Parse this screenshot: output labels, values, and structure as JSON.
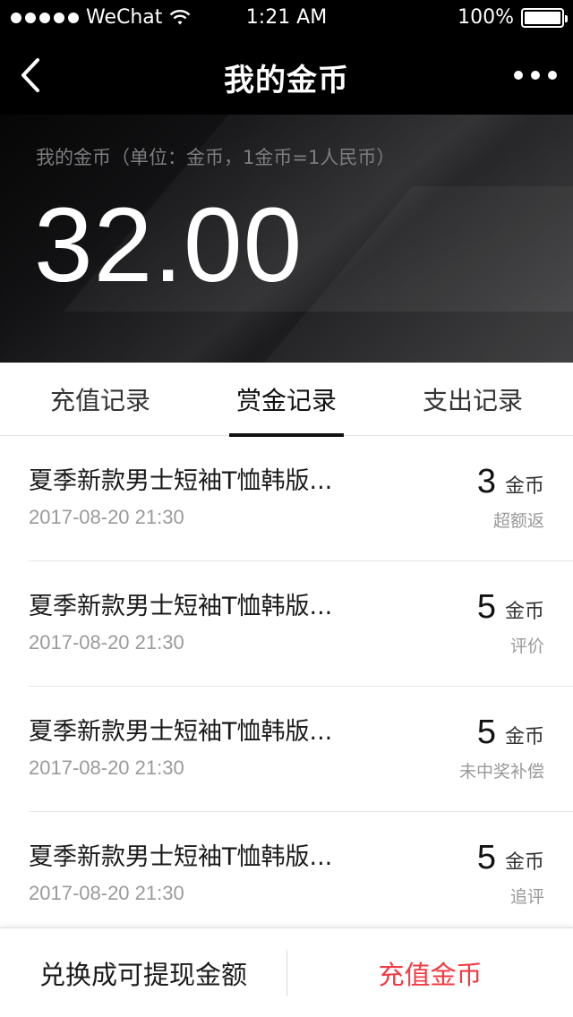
{
  "status_bar": {
    "carrier": "WeChat",
    "time": "1:21 AM",
    "battery": "100%",
    "battery_level": 1.0
  },
  "nav": {
    "title": "我的金币",
    "back_icon": "chevron-left-icon",
    "more_icon": "more-dots-icon"
  },
  "balance": {
    "caption": "我的金币（单位：金币，1金币=1人民币）",
    "amount": "32.00"
  },
  "tabs": [
    {
      "label": "充值记录",
      "active": false
    },
    {
      "label": "赏金记录",
      "active": true
    },
    {
      "label": "支出记录",
      "active": false
    }
  ],
  "records": [
    {
      "title": "夏季新款男士短袖T恤韩版...",
      "time": "2017-08-20 21:30",
      "amount": "3",
      "unit": "金币",
      "tag": "超额返"
    },
    {
      "title": "夏季新款男士短袖T恤韩版...",
      "time": "2017-08-20 21:30",
      "amount": "5",
      "unit": "金币",
      "tag": "评价"
    },
    {
      "title": "夏季新款男士短袖T恤韩版...",
      "time": "2017-08-20 21:30",
      "amount": "5",
      "unit": "金币",
      "tag": "未中奖补偿"
    },
    {
      "title": "夏季新款男士短袖T恤韩版...",
      "time": "2017-08-20 21:30",
      "amount": "5",
      "unit": "金币",
      "tag": "追评"
    }
  ],
  "bottom_bar": {
    "exchange_label": "兑换成可提现金额",
    "recharge_label": "充值金币",
    "recharge_color": "#f23b43"
  }
}
